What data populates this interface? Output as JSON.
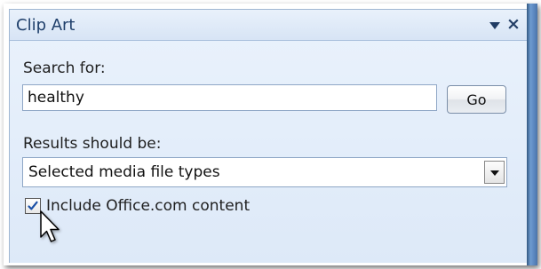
{
  "panel": {
    "title": "Clip Art",
    "close_glyph": "×"
  },
  "search": {
    "label": "Search for:",
    "value": "healthy",
    "go_label": "Go"
  },
  "results": {
    "label": "Results should be:",
    "selected_value": "Selected media file types"
  },
  "office_content": {
    "checked": true,
    "label": "Include Office.com content"
  },
  "colors": {
    "accent": "#1f3f6b",
    "panel_background": "#e3edf9",
    "border": "#8fa7c6"
  }
}
